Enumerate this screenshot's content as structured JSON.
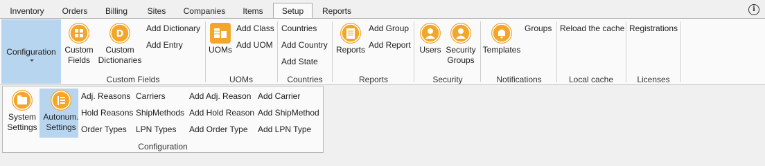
{
  "tabs": [
    "Inventory",
    "Orders",
    "Billing",
    "Sites",
    "Companies",
    "Items",
    "Setup",
    "Reports"
  ],
  "active_tab": "Setup",
  "ribbon": {
    "configuration_label": "Configuration",
    "custom_fields": {
      "btn1_l1": "Custom",
      "btn1_l2": "Fields",
      "btn2_l1": "Custom",
      "btn2_l2": "Dictionaries",
      "add_dictionary": "Add Dictionary",
      "add_entry": "Add Entry",
      "group": "Custom Fields"
    },
    "uoms": {
      "uoms": "UOMs",
      "add_class": "Add Class",
      "add_uom": "Add UOM",
      "group": "UOMs"
    },
    "countries": {
      "countries": "Countries",
      "add_country": "Add Country",
      "add_state": "Add State",
      "group": "Countries"
    },
    "reports": {
      "reports": "Reports",
      "add_group": "Add Group",
      "add_report": "Add Report",
      "group": "Reports"
    },
    "security": {
      "users": "Users",
      "sec_l1": "Security",
      "sec_l2": "Groups",
      "group": "Security"
    },
    "notifications": {
      "templates": "Templates",
      "groups": "Groups",
      "group": "Notifications"
    },
    "cache": {
      "reload": "Reload the cache",
      "group": "Local cache"
    },
    "licenses": {
      "registrations": "Registrations",
      "group": "Licenses"
    }
  },
  "dropdown": {
    "system_l1": "System",
    "system_l2": "Settings",
    "autonum_l1": "Autonum.",
    "autonum_l2": "Settings",
    "col1": [
      "Adj. Reasons",
      "Hold Reasons",
      "Order Types"
    ],
    "col2": [
      "Carriers",
      "ShipMethods",
      "LPN Types"
    ],
    "col3": [
      "Add Adj. Reason",
      "Add Hold Reason",
      "Add Order Type"
    ],
    "col4": [
      "Add Carrier",
      "Add ShipMethod",
      "Add LPN Type"
    ],
    "group": "Configuration"
  },
  "colors": {
    "accent": "#f2a72a",
    "highlight": "#b8d5ef"
  }
}
